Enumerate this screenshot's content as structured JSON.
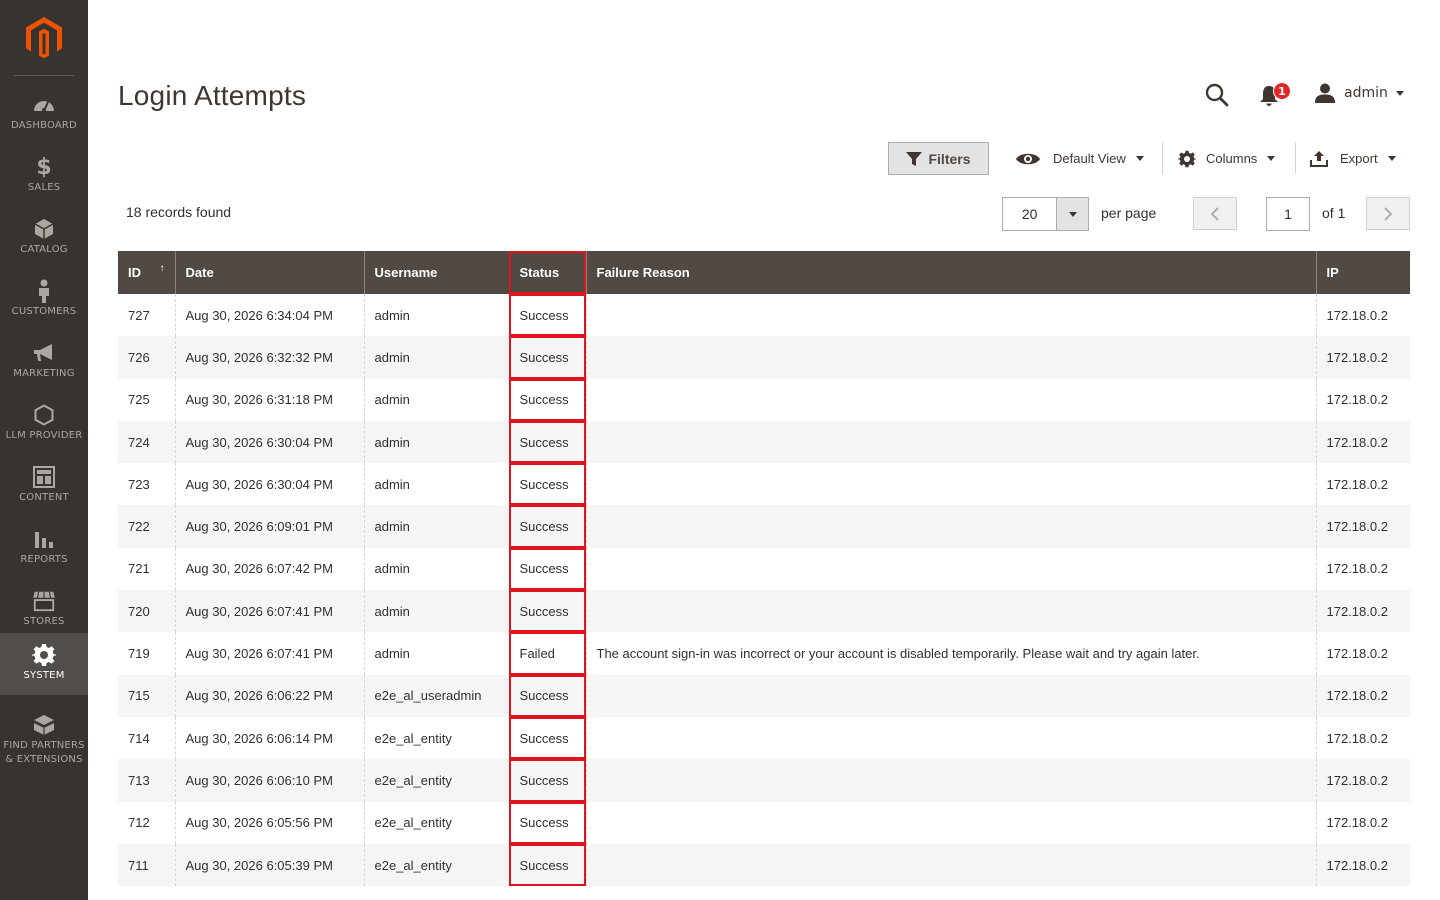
{
  "sidebar": {
    "items": [
      {
        "label": "Dashboard",
        "icon": "dashboard-icon"
      },
      {
        "label": "Sales",
        "icon": "dollar-icon"
      },
      {
        "label": "Catalog",
        "icon": "box-icon"
      },
      {
        "label": "Customers",
        "icon": "person-icon"
      },
      {
        "label": "Marketing",
        "icon": "megaphone-icon"
      },
      {
        "label": "LLM Provider",
        "icon": "hexagon-icon"
      },
      {
        "label": "Content",
        "icon": "layout-icon"
      },
      {
        "label": "Reports",
        "icon": "bar-chart-icon"
      },
      {
        "label": "Stores",
        "icon": "store-icon"
      },
      {
        "label": "System",
        "icon": "gear-icon"
      },
      {
        "label": "Find Partners & Extensions",
        "icon": "blocks-icon"
      }
    ]
  },
  "header": {
    "title": "Login Attempts",
    "notifications_count": "1",
    "user": "admin"
  },
  "toolbar": {
    "filters": "Filters",
    "view": "Default View",
    "columns": "Columns",
    "export": "Export"
  },
  "pager": {
    "records": "18 records found",
    "per_page_value": "20",
    "per_page_label": "per page",
    "current_page": "1",
    "of_label": "of 1"
  },
  "table": {
    "columns": [
      "ID",
      "Date",
      "Username",
      "Status",
      "Failure Reason",
      "IP"
    ],
    "rows": [
      {
        "id": "727",
        "date": "Aug 30, 2026 6:34:04 PM",
        "username": "admin",
        "status": "Success",
        "reason": "",
        "ip": "172.18.0.2"
      },
      {
        "id": "726",
        "date": "Aug 30, 2026 6:32:32 PM",
        "username": "admin",
        "status": "Success",
        "reason": "",
        "ip": "172.18.0.2"
      },
      {
        "id": "725",
        "date": "Aug 30, 2026 6:31:18 PM",
        "username": "admin",
        "status": "Success",
        "reason": "",
        "ip": "172.18.0.2"
      },
      {
        "id": "724",
        "date": "Aug 30, 2026 6:30:04 PM",
        "username": "admin",
        "status": "Success",
        "reason": "",
        "ip": "172.18.0.2"
      },
      {
        "id": "723",
        "date": "Aug 30, 2026 6:30:04 PM",
        "username": "admin",
        "status": "Success",
        "reason": "",
        "ip": "172.18.0.2"
      },
      {
        "id": "722",
        "date": "Aug 30, 2026 6:09:01 PM",
        "username": "admin",
        "status": "Success",
        "reason": "",
        "ip": "172.18.0.2"
      },
      {
        "id": "721",
        "date": "Aug 30, 2026 6:07:42 PM",
        "username": "admin",
        "status": "Success",
        "reason": "",
        "ip": "172.18.0.2"
      },
      {
        "id": "720",
        "date": "Aug 30, 2026 6:07:41 PM",
        "username": "admin",
        "status": "Success",
        "reason": "",
        "ip": "172.18.0.2"
      },
      {
        "id": "719",
        "date": "Aug 30, 2026 6:07:41 PM",
        "username": "admin",
        "status": "Failed",
        "reason": "The account sign-in was incorrect or your account is disabled temporarily. Please wait and try again later.",
        "ip": "172.18.0.2"
      },
      {
        "id": "715",
        "date": "Aug 30, 2026 6:06:22 PM",
        "username": "e2e_al_useradmin",
        "status": "Success",
        "reason": "",
        "ip": "172.18.0.2"
      },
      {
        "id": "714",
        "date": "Aug 30, 2026 6:06:14 PM",
        "username": "e2e_al_entity",
        "status": "Success",
        "reason": "",
        "ip": "172.18.0.2"
      },
      {
        "id": "713",
        "date": "Aug 30, 2026 6:06:10 PM",
        "username": "e2e_al_entity",
        "status": "Success",
        "reason": "",
        "ip": "172.18.0.2"
      },
      {
        "id": "712",
        "date": "Aug 30, 2026 6:05:56 PM",
        "username": "e2e_al_entity",
        "status": "Success",
        "reason": "",
        "ip": "172.18.0.2"
      },
      {
        "id": "711",
        "date": "Aug 30, 2026 6:05:39 PM",
        "username": "e2e_al_entity",
        "status": "Success",
        "reason": "",
        "ip": "172.18.0.2"
      }
    ]
  },
  "colors": {
    "sidebar_bg": "#373330",
    "header_bg": "#514943",
    "accent": "#eb5202",
    "highlight": "#e0141e"
  }
}
